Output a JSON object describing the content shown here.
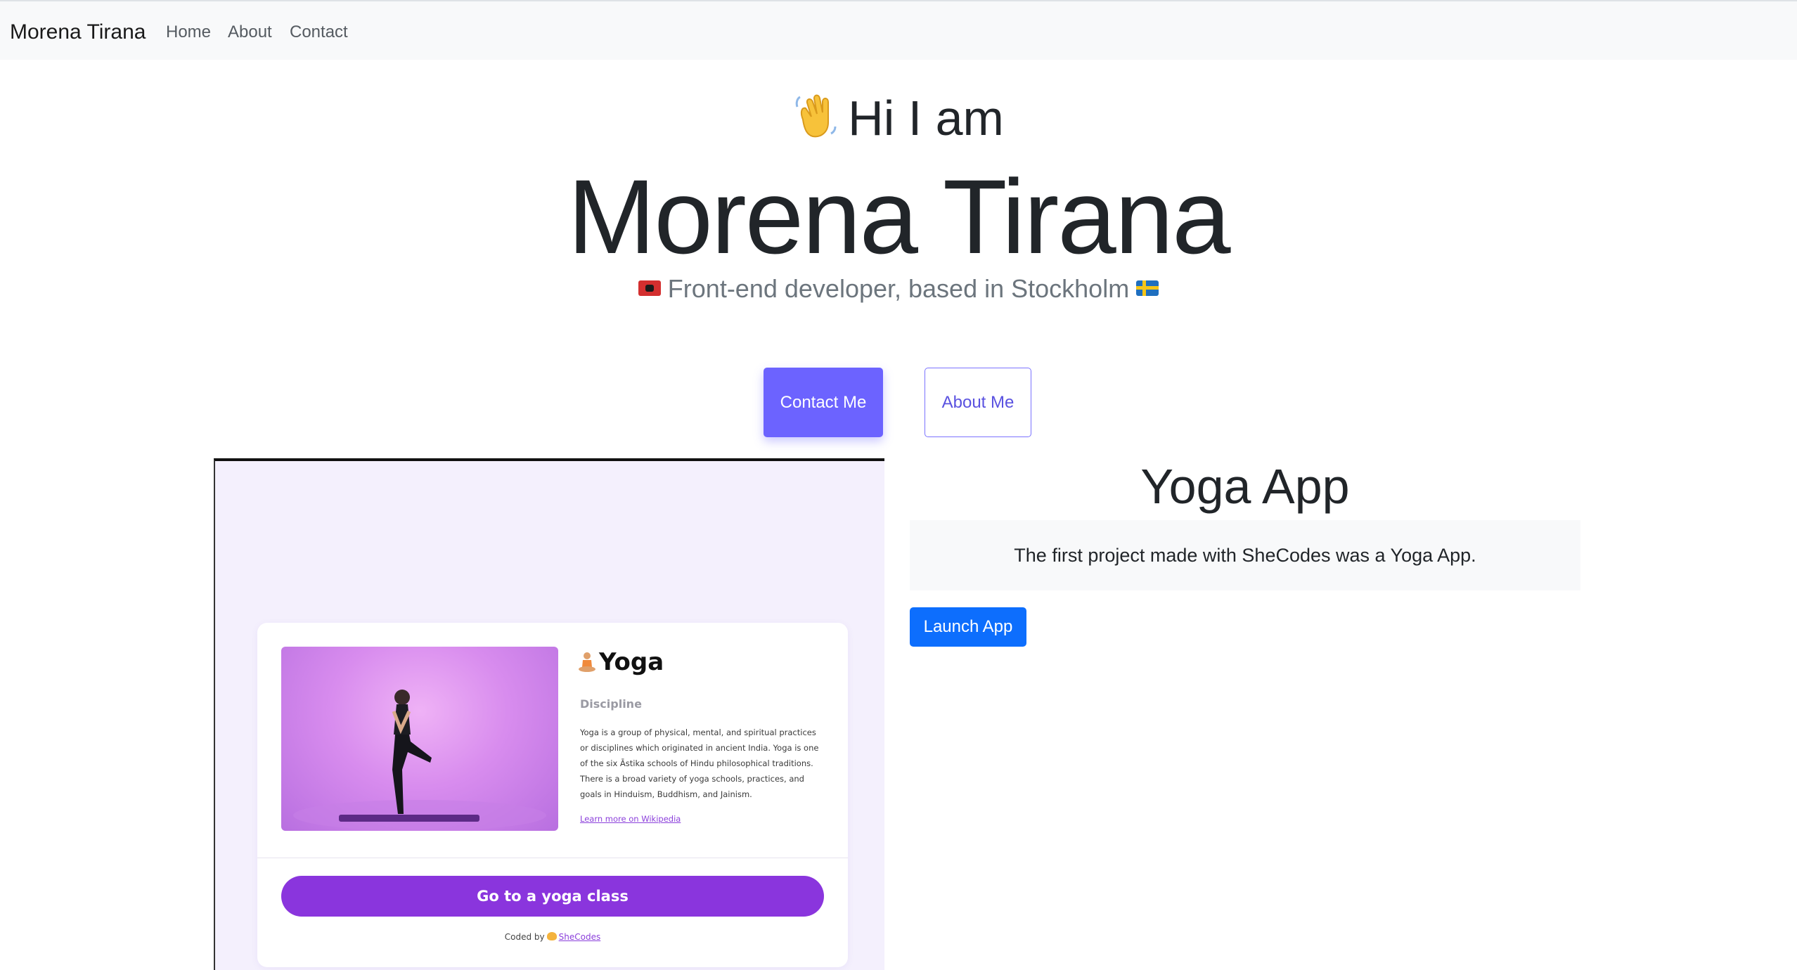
{
  "navbar": {
    "brand": "Morena Tirana",
    "links": [
      "Home",
      "About",
      "Contact"
    ]
  },
  "hero": {
    "intro": "Hi I am",
    "intro_icon": "waving-hand-icon",
    "name": "Morena Tirana",
    "subtitle": "Front-end developer, based in Stockholm",
    "subtitle_icons": [
      "albania-flag-icon",
      "sweden-flag-icon"
    ],
    "buttons": {
      "contact": "Contact Me",
      "about": "About Me"
    }
  },
  "colors": {
    "accent": "#6c63ff",
    "launch_button": "#0d6efd",
    "yoga_purple": "#8a35dd",
    "navbar_bg": "#f8f9fa"
  },
  "project": {
    "title": "Yoga App",
    "description": "The first project made with SheCodes was a Yoga App.",
    "launch_label": "Launch App",
    "preview": {
      "title": "Yoga",
      "title_icon": "lotus-position-icon",
      "label": "Discipline",
      "description": "Yoga is a group of physical, mental, and spiritual practices or disciplines which originated in ancient India. Yoga is one of the six Āstika schools of Hindu philosophical traditions. There is a broad variety of yoga schools, practices, and goals in Hinduism, Buddhism, and Jainism.",
      "link": "Learn more on Wikipedia",
      "button": "Go to a yoga class",
      "footer_prefix": "Coded by",
      "footer_link": "SheCodes"
    }
  }
}
